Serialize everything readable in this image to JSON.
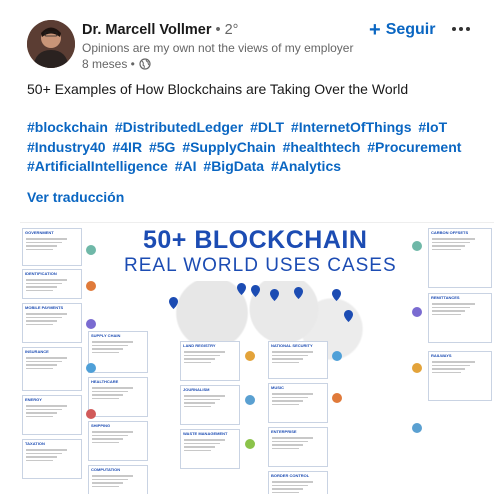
{
  "post": {
    "author": {
      "name": "Dr. Marcell Vollmer",
      "degree": " • 2°",
      "headline": "Opinions are my own not the views of my employer",
      "time": "8 meses •"
    },
    "follow_label": "Seguir",
    "title": "50+ Examples of How Blockchains are Taking Over the World",
    "hashtags": [
      "#blockchain",
      "#DistributedLedger",
      "#DLT",
      "#InternetOfThings",
      "#IoT",
      "#Industry40",
      "#4IR",
      "#5G",
      "#SupplyChain",
      "#healthtech",
      "#Procurement",
      "#ArtificialIntelligence",
      "#AI",
      "#BigData",
      "#Analytics"
    ],
    "translate_label": "Ver traducción"
  },
  "infographic": {
    "title_line1": "50+ BLOCKCHAIN",
    "title_line2": "REAL WORLD USES CASES",
    "sections": [
      "GOVERNMENT",
      "IDENTIFICATION",
      "MOBILE PAYMENTS",
      "INSURANCE",
      "ENERGY",
      "TAXATION",
      "SUPPLY CHAIN",
      "HEALTHCARE",
      "SHIPPING",
      "COMPUTATION",
      "LAND REGISTRY",
      "JOURNALISM",
      "WASTE MANAGEMENT",
      "NATIONAL SECURITY",
      "MUSIC",
      "ENTERPRISE",
      "BORDER CONTROL",
      "CARBON OFFSETS",
      "REMITTANCES",
      "RAILWAYS"
    ],
    "logos": [
      "upalt",
      "ripple",
      "AIG",
      "IBM",
      "Walmart",
      "CNE",
      "IBM",
      "CIVIL",
      "Google",
      "orbit",
      "De Beers"
    ],
    "accent_color": "#1c4cb3"
  }
}
